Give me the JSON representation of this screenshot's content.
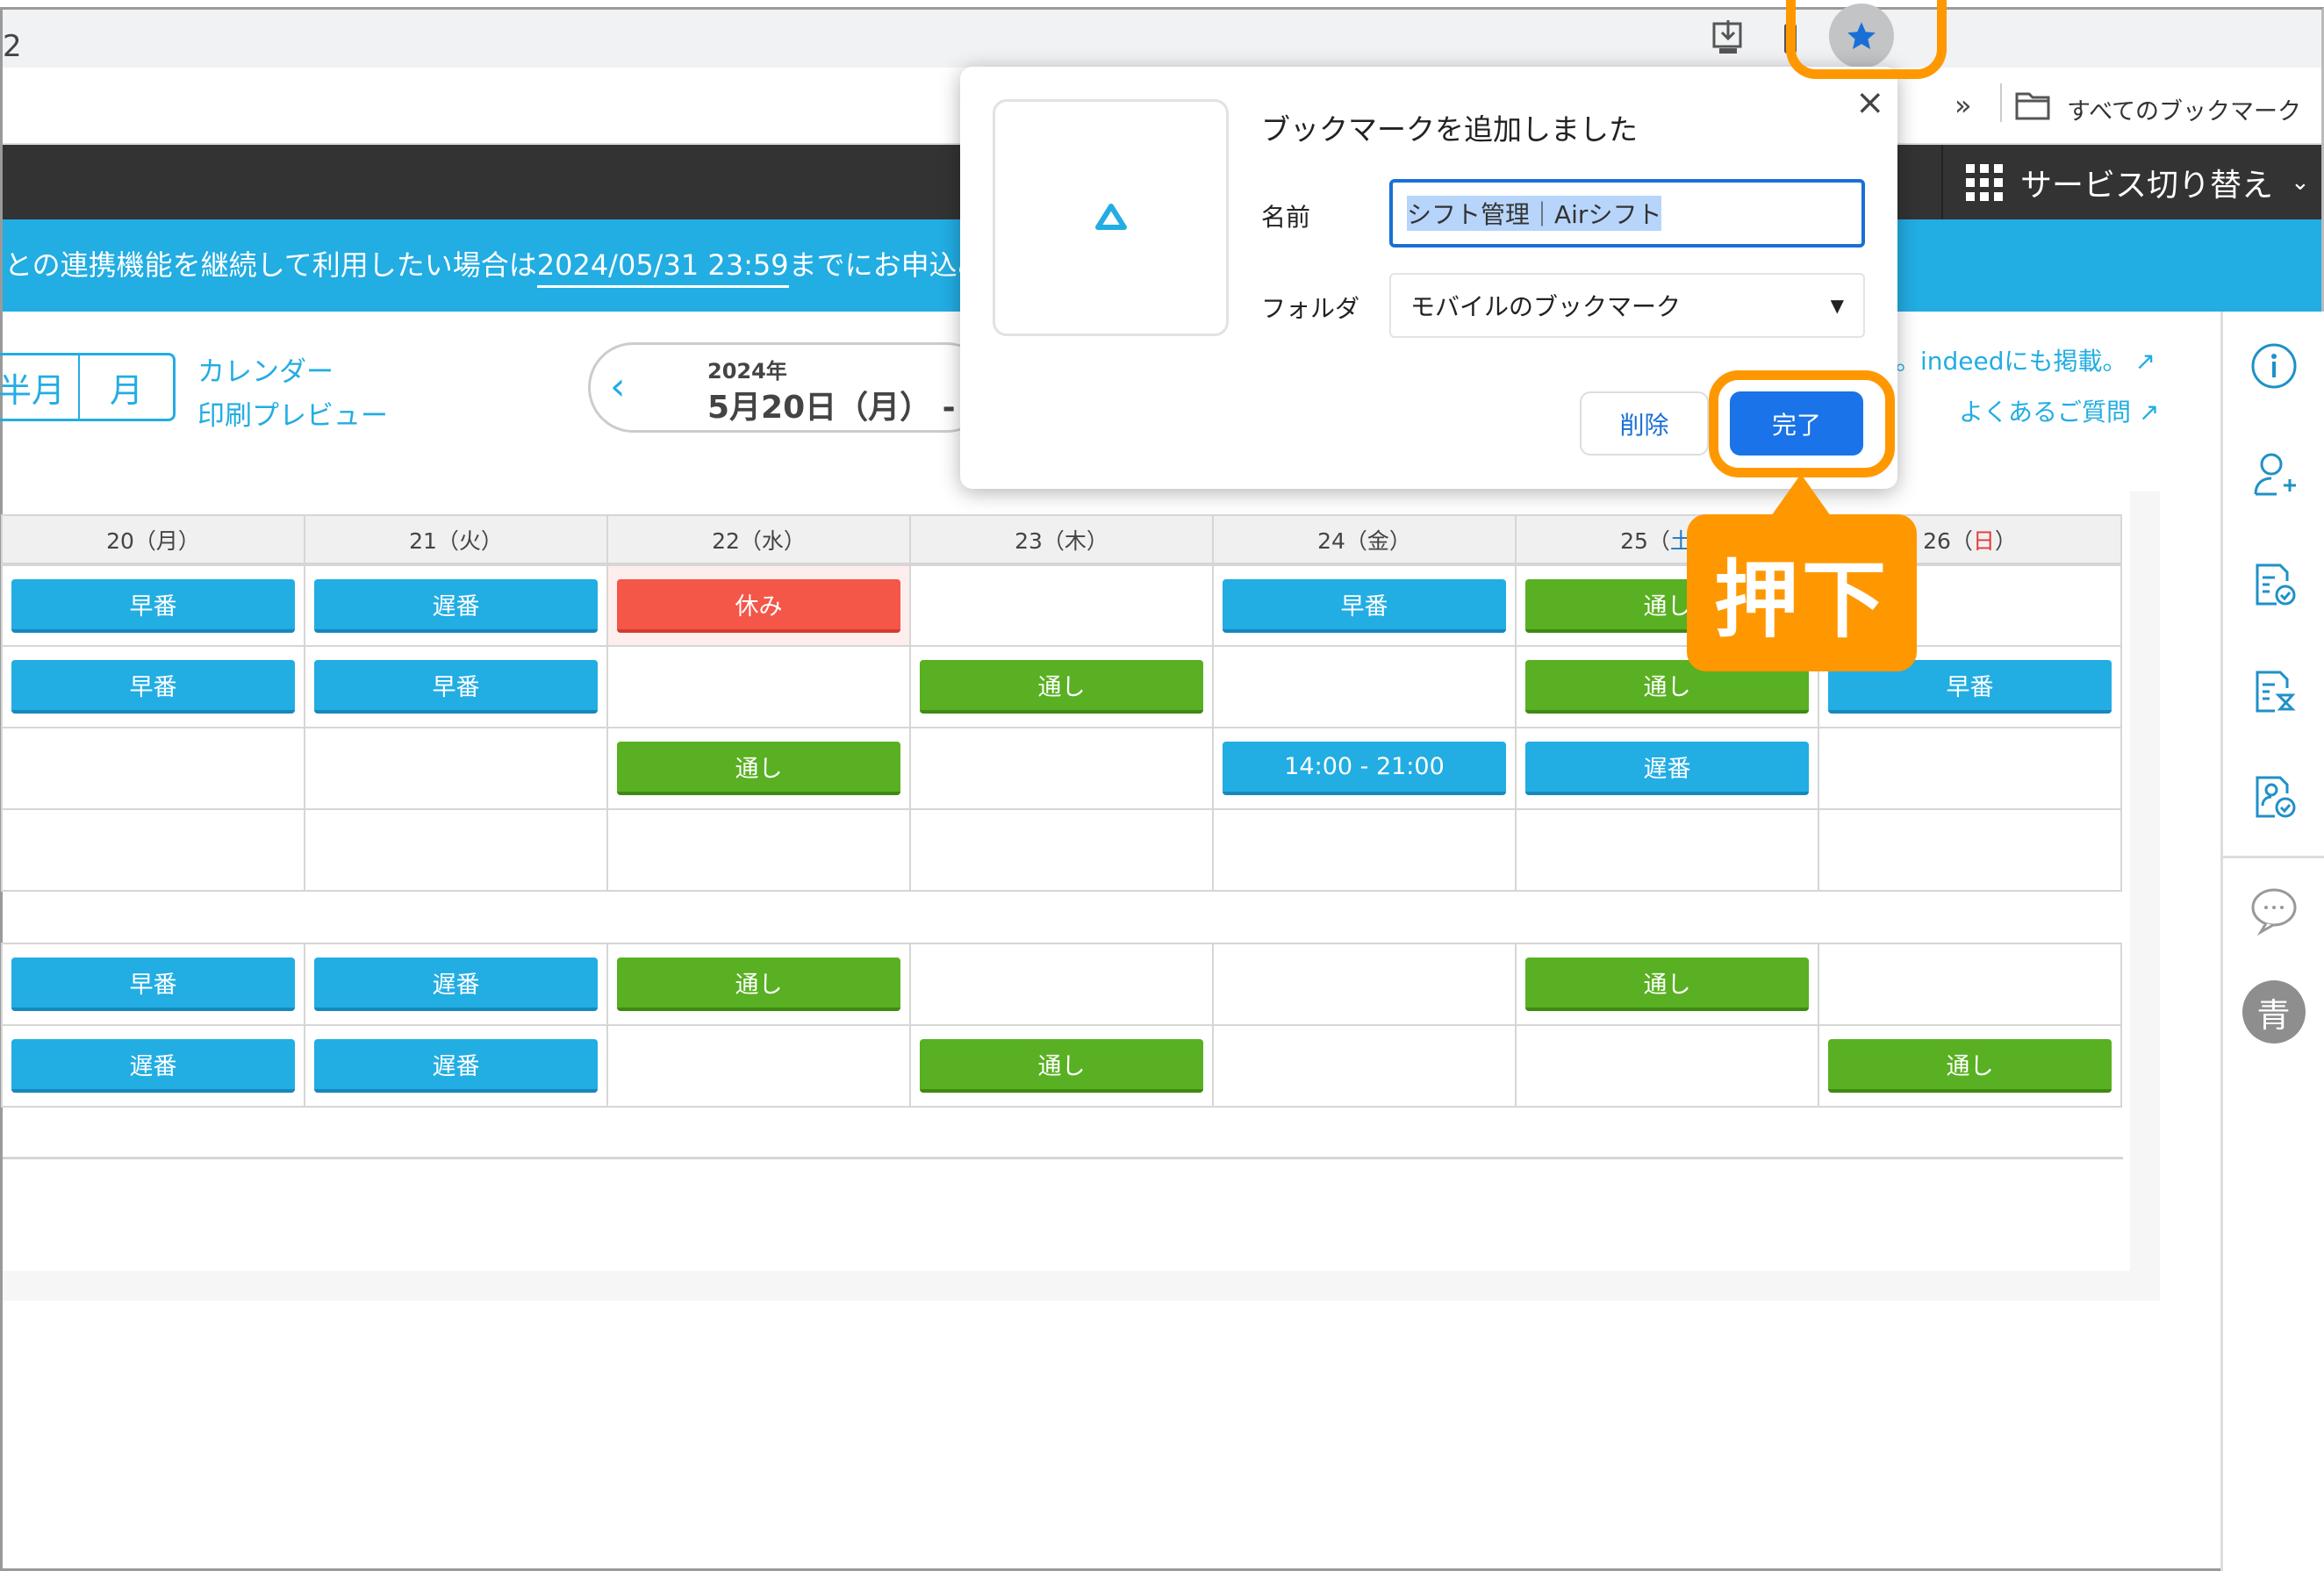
{
  "browser": {
    "tab_fragment": "2",
    "bookmarks_overflow": "»",
    "all_bookmarks_label": "すべてのブックマーク",
    "bookmark_star_active": true
  },
  "header": {
    "service_switch_label": "サービス切り替え"
  },
  "banner": {
    "text_before": "との連携機能を継続して利用したい場合は",
    "deadline": "2024/05/31 23:59",
    "text_after": "までにお申込みく"
  },
  "toolbar": {
    "view_half_month": "半月",
    "view_month": "月",
    "calendar_label": "カレンダー",
    "print_preview_label": "印刷プレビュー",
    "date_year": "2024年",
    "date_start": "5月20日（月） -",
    "indeed_link": "。indeedにも掲載。",
    "faq_link": "よくあるご質問"
  },
  "calendar": {
    "headers": [
      {
        "day": "20",
        "wd": "月",
        "type": "weekday"
      },
      {
        "day": "21",
        "wd": "火",
        "type": "weekday"
      },
      {
        "day": "22",
        "wd": "水",
        "type": "weekday"
      },
      {
        "day": "23",
        "wd": "木",
        "type": "weekday"
      },
      {
        "day": "24",
        "wd": "金",
        "type": "weekday"
      },
      {
        "day": "25",
        "wd": "土",
        "type": "sat"
      },
      {
        "day": "26",
        "wd": "日",
        "type": "sun"
      }
    ],
    "groups": [
      [
        [
          "早番",
          "遅番",
          "休み",
          "",
          "早番",
          "通し",
          ""
        ],
        [
          "早番",
          "早番",
          "",
          "通し",
          "",
          "通し",
          "早番"
        ],
        [
          "",
          "",
          "通し",
          "",
          "14:00 - 21:00",
          "遅番",
          ""
        ],
        [
          "",
          "",
          "",
          "",
          "",
          "",
          ""
        ]
      ],
      [
        [
          "早番",
          "遅番",
          "通し",
          "",
          "",
          "通し",
          ""
        ],
        [
          "遅番",
          "遅番",
          "",
          "通し",
          "",
          "",
          "通し"
        ]
      ]
    ],
    "colors": {
      "早番": "#22ade3",
      "遅番": "#22ade3",
      "14:00 - 21:00": "#22ade3",
      "通し": "#58b022",
      "休み": "#f45647"
    }
  },
  "sidebar": {
    "icons": [
      "info-icon",
      "add-user-icon",
      "document-check-icon",
      "document-pending-icon",
      "staff-approve-icon",
      "chat-icon"
    ],
    "avatar": "青"
  },
  "dialog": {
    "title": "ブックマークを追加しました",
    "name_label": "名前",
    "name_value": "シフト管理｜Airシフト",
    "folder_label": "フォルダ",
    "folder_value": "モバイルのブックマーク",
    "delete_label": "削除",
    "done_label": "完了",
    "close": "×"
  },
  "annotation": {
    "callout": "押下",
    "accent": "#ff9800"
  }
}
